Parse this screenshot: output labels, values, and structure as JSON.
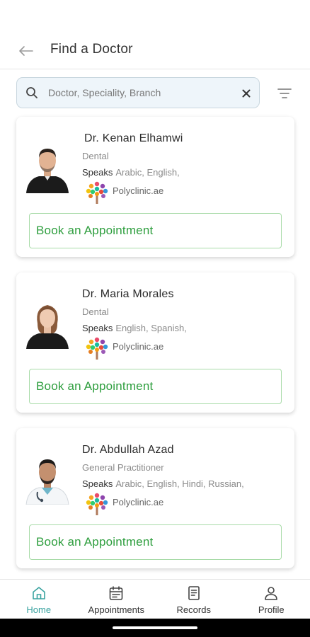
{
  "header": {
    "title": "Find a Doctor"
  },
  "search": {
    "placeholder": "Doctor, Speciality, Branch",
    "value": ""
  },
  "doctors": [
    {
      "name": "Dr. Kenan Elhamwi",
      "speciality": "Dental",
      "speaks_label": "Speaks",
      "languages": "Arabic,  English,",
      "branch": "Polyclinic.ae",
      "book_label": "Book an Appointment"
    },
    {
      "name": "Dr. Maria Morales",
      "speciality": "Dental",
      "speaks_label": "Speaks",
      "languages": "English,  Spanish,",
      "branch": "Polyclinic.ae",
      "book_label": "Book an Appointment"
    },
    {
      "name": "Dr. Abdullah Azad",
      "speciality": "General Practitioner",
      "speaks_label": "Speaks",
      "languages": "Arabic,  English,  Hindi,  Russian,",
      "branch": "Polyclinic.ae",
      "book_label": "Book an Appointment"
    }
  ],
  "nav": {
    "home": "Home",
    "appointments": "Appointments",
    "records": "Records",
    "profile": "Profile",
    "active": "home"
  },
  "colors": {
    "accent": "#2e9e3e",
    "nav_active": "#3aa3a0",
    "search_bg": "#eef5fa"
  }
}
